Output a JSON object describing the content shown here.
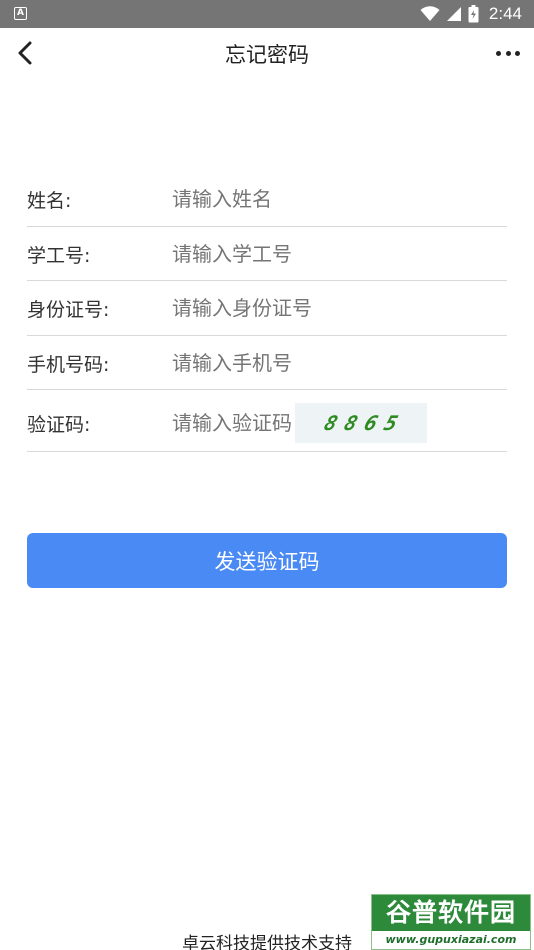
{
  "status_bar": {
    "time": "2:44",
    "app_icon_letter": "A",
    "icons": [
      "wifi-icon",
      "signal-icon",
      "battery-icon"
    ]
  },
  "app_bar": {
    "title": "忘记密码",
    "back_icon": "chevron-left-icon",
    "more_icon": "more-horizontal-icon"
  },
  "form": {
    "fields": [
      {
        "label": "姓名:",
        "placeholder": "请输入姓名",
        "value": ""
      },
      {
        "label": "学工号:",
        "placeholder": "请输入学工号",
        "value": ""
      },
      {
        "label": "身份证号:",
        "placeholder": "请输入身份证号",
        "value": ""
      },
      {
        "label": "手机号码:",
        "placeholder": "请输入手机号",
        "value": ""
      },
      {
        "label": "验证码:",
        "placeholder": "请输入验证码",
        "value": ""
      }
    ],
    "captcha": [
      "8",
      "8",
      "6",
      "5"
    ]
  },
  "send_button_label": "发送验证码",
  "footer": "卓云科技提供技术支持",
  "watermark": {
    "brand": "谷普软件园",
    "url": "www.gupuxiazai.com"
  },
  "colors": {
    "accent": "#4a8af4",
    "status_bar": "#757575",
    "captcha_text": "#2e8b22"
  }
}
